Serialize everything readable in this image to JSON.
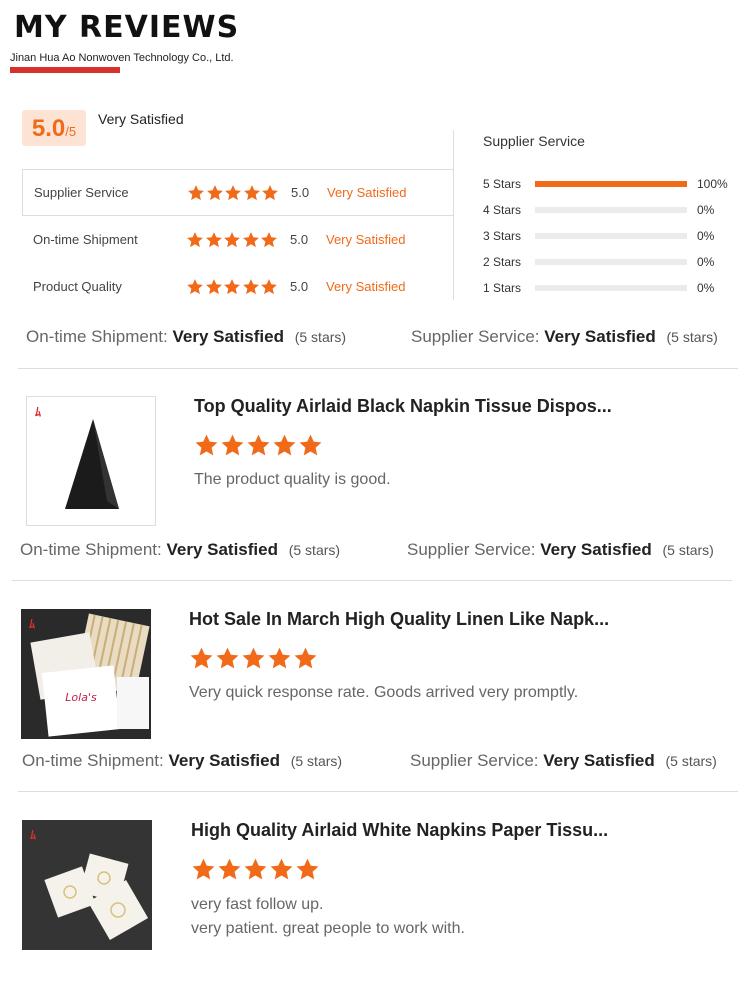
{
  "header": {
    "title": "MY REVIEWS",
    "company": "Jinan Hua Ao Nonwoven Technology Co., Ltd."
  },
  "overall": {
    "score": "5.0",
    "out_of": "/5",
    "label": "Very Satisfied"
  },
  "ratings": [
    {
      "name": "Supplier Service",
      "stars": 5,
      "score": "5.0",
      "label": "Very Satisfied"
    },
    {
      "name": "On-time Shipment",
      "stars": 5,
      "score": "5.0",
      "label": "Very Satisfied"
    },
    {
      "name": "Product Quality",
      "stars": 5,
      "score": "5.0",
      "label": "Very Satisfied"
    }
  ],
  "distribution": {
    "title": "Supplier Service",
    "rows": [
      {
        "label": "5  Stars",
        "pct": "100%",
        "fraction": 1.0
      },
      {
        "label": "4  Stars",
        "pct": "0%",
        "fraction": 0
      },
      {
        "label": "3  Stars",
        "pct": "0%",
        "fraction": 0
      },
      {
        "label": "2  Stars",
        "pct": "0%",
        "fraction": 0
      },
      {
        "label": "1  Stars",
        "pct": "0%",
        "fraction": 0
      }
    ]
  },
  "summary_labels": {
    "shipment": "On-time Shipment:",
    "service": "Supplier Service:",
    "value": "Very Satisfied",
    "stars_note": "(5 stars)"
  },
  "reviews": [
    {
      "title": "Top Quality Airlaid Black Napkin Tissue Dispos...",
      "stars": 5,
      "text": "The product quality is good.",
      "thumb": "black-napkin"
    },
    {
      "title": "Hot Sale In March High Quality Linen Like Napk...",
      "stars": 5,
      "text": "Very quick response rate. Goods arrived very promptly.",
      "thumb": "linen-napkins"
    },
    {
      "title": "High Quality Airlaid White Napkins Paper Tissu...",
      "stars": 5,
      "text_line1": "very fast follow up.",
      "text_line2": "very patient. great people to work with.",
      "thumb": "white-napkins"
    }
  ],
  "icons": {
    "star": "star-icon",
    "logo": "brand-logo-icon"
  },
  "colors": {
    "accent": "#f06a1a",
    "brand_red": "#d6322b",
    "score_bg": "#fde3d4"
  }
}
